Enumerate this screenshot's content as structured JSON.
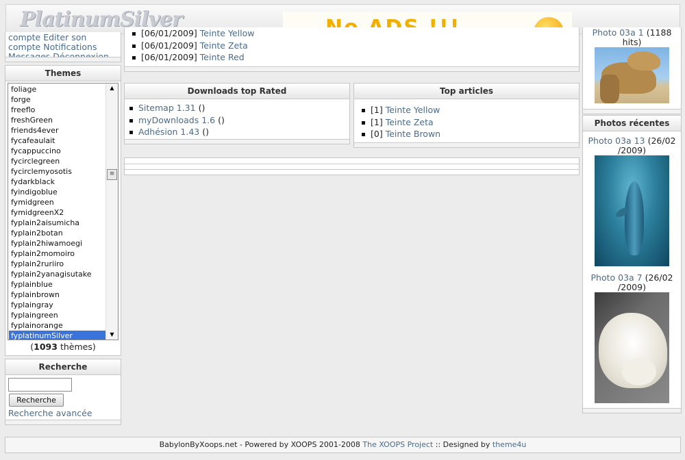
{
  "header": {
    "logo": "PlatinumSilver",
    "banner_text": "No ADS !!!"
  },
  "usermenu": {
    "links": [
      "compte",
      "Editer son",
      "compte",
      "Notifications",
      "Messages",
      "Déconnexion"
    ]
  },
  "themes": {
    "title": "Themes",
    "items": [
      "foliage",
      "forge",
      "freeflo",
      "freshGreen",
      "friends4ever",
      "fycafeaulait",
      "fycappuccino",
      "fycirclegreen",
      "fycirclemyosotis",
      "fydarkblack",
      "fyindigoblue",
      "fymidgreen",
      "fymidgreenX2",
      "fyplain2aisumicha",
      "fyplain2botan",
      "fyplain2hiwamoegi",
      "fyplain2momoiro",
      "fyplain2ruriiro",
      "fyplain2yanagisutake",
      "fyplainblue",
      "fyplainbrown",
      "fyplaingray",
      "fyplaingreen",
      "fyplainorange",
      "fyplatinumSilver"
    ],
    "selected": "fyplatinumSilver",
    "count_open": "(",
    "count": "1093",
    "count_close": "thèmes)"
  },
  "search": {
    "title": "Recherche",
    "input_value": "",
    "button": "Recherche",
    "advanced": "Recherche avancée"
  },
  "news": {
    "items": [
      {
        "date": "[06/01/2009]",
        "title": "Teinte Yellow"
      },
      {
        "date": "[06/01/2009]",
        "title": "Teinte Zeta"
      },
      {
        "date": "[06/01/2009]",
        "title": "Teinte Red"
      }
    ]
  },
  "downloads": {
    "title": "Downloads top Rated",
    "items": [
      {
        "name": "Sitemap 1.31",
        "extra": "()"
      },
      {
        "name": "myDownloads 1.6",
        "extra": "()"
      },
      {
        "name": "Adhésion 1.43",
        "extra": "()"
      }
    ]
  },
  "top_articles": {
    "title": "Top articles",
    "items": [
      {
        "count": "[1]",
        "title": "Teinte Yellow"
      },
      {
        "count": "[1]",
        "title": "Teinte Zeta"
      },
      {
        "count": "[0]",
        "title": "Teinte Brown"
      }
    ]
  },
  "top_photo": {
    "name": "Photo 03a 1",
    "hits_a": "(1188",
    "hits_b": "hits)"
  },
  "recent_photos": {
    "title": "Photos récentes",
    "items": [
      {
        "name": "Photo 03a 13",
        "date_a": "(26/02",
        "date_b": "/2009)"
      },
      {
        "name": "Photo 03a 7",
        "date_a": "(26/02",
        "date_b": "/2009)"
      }
    ]
  },
  "footer": {
    "prefix": "BabylonByXoops.net - Powered by XOOPS 2001-2008",
    "project_link": "The XOOPS Project",
    "designed": ":: Designed by",
    "designer_link": "theme4u"
  }
}
